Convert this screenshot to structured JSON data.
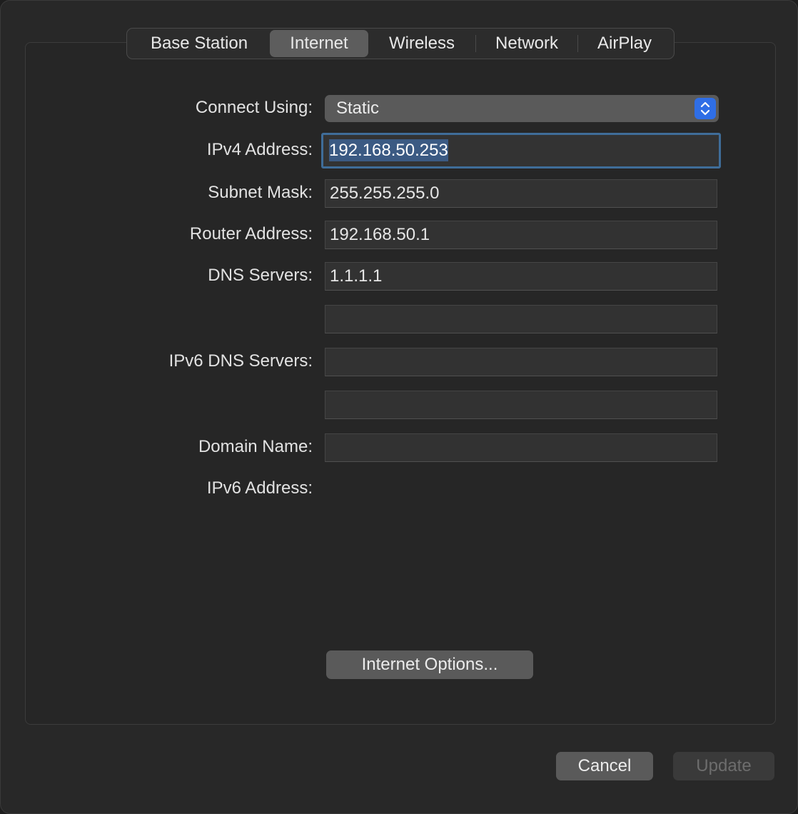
{
  "tabs": [
    {
      "label": "Base Station",
      "selected": false
    },
    {
      "label": "Internet",
      "selected": true
    },
    {
      "label": "Wireless",
      "selected": false
    },
    {
      "label": "Network",
      "selected": false
    },
    {
      "label": "AirPlay",
      "selected": false
    }
  ],
  "form": {
    "connect_using": {
      "label": "Connect Using:",
      "value": "Static"
    },
    "ipv4_address": {
      "label": "IPv4 Address:",
      "value": "192.168.50.253"
    },
    "subnet_mask": {
      "label": "Subnet Mask:",
      "value": "255.255.255.0"
    },
    "router_address": {
      "label": "Router Address:",
      "value": "192.168.50.1"
    },
    "dns_servers": {
      "label": "DNS Servers:",
      "value1": "1.1.1.1",
      "value2": ""
    },
    "ipv6_dns_servers": {
      "label": "IPv6 DNS Servers:",
      "value1": "",
      "value2": ""
    },
    "domain_name": {
      "label": "Domain Name:",
      "value": ""
    },
    "ipv6_address": {
      "label": "IPv6 Address:",
      "value": ""
    }
  },
  "buttons": {
    "internet_options": "Internet Options...",
    "cancel": "Cancel",
    "update": "Update"
  },
  "colors": {
    "accent": "#2f6ee6",
    "focus_ring": "#3f6d99",
    "selection": "#3b5a83"
  }
}
